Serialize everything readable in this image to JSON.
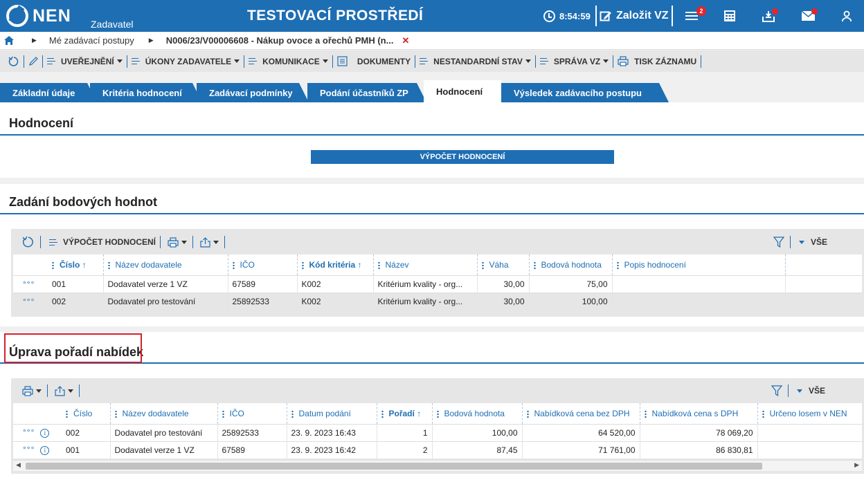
{
  "topbar": {
    "logo": "NEN",
    "logo_sub": "Zadavatel",
    "env_title": "TESTOVACÍ PROSTŘEDÍ",
    "time": "8:54:59",
    "create_label": "Založit VZ",
    "menu_badge": "2",
    "colors": {
      "primary": "#1e6eb3",
      "badge": "#e6252b"
    }
  },
  "breadcrumb": {
    "items": [
      "Mé zadávací postupy",
      "N006/23/V00006608 - Nákup ovoce a ořechů PMH (n..."
    ],
    "close_glyph": "✕"
  },
  "toolbar": {
    "items": [
      "UVEŘEJNĚNÍ",
      "ÚKONY ZADAVATELE",
      "KOMUNIKACE",
      "DOKUMENTY",
      "NESTANDARDNÍ STAV",
      "SPRÁVA VZ",
      "TISK ZÁZNAMU"
    ]
  },
  "tabs": [
    "Základní údaje",
    "Kritéria hodnocení",
    "Zadávací podmínky",
    "Podání účastníků ZP",
    "Hodnocení",
    "Výsledek zadávacího postupu"
  ],
  "section1": {
    "title": "Hodnocení",
    "button": "VÝPOČET HODNOCENÍ"
  },
  "section2": {
    "title": "Zadání bodových hodnot",
    "toolbar_button": "VÝPOČET HODNOCENÍ",
    "filter_label": "VŠE",
    "columns": [
      "Číslo",
      "Název dodavatele",
      "IČO",
      "Kód kritéria",
      "Název",
      "Váha",
      "Bodová hodnota",
      "Popis hodnocení"
    ],
    "rows": [
      {
        "cislo": "001",
        "nazev_dodavatele": "Dodavatel verze 1 VZ",
        "ico": "67589",
        "kod": "K002",
        "nazev": "Kritérium kvality - org...",
        "vaha": "30,00",
        "bodova": "75,00",
        "popis": ""
      },
      {
        "cislo": "002",
        "nazev_dodavatele": "Dodavatel pro testování",
        "ico": "25892533",
        "kod": "K002",
        "nazev": "Kritérium kvality - org...",
        "vaha": "30,00",
        "bodova": "100,00",
        "popis": ""
      }
    ]
  },
  "section3": {
    "title": "Úprava pořadí nabídek",
    "filter_label": "VŠE",
    "columns": [
      "Číslo",
      "Název dodavatele",
      "IČO",
      "Datum podání",
      "Pořadí",
      "Bodová hodnota",
      "Nabídková cena bez DPH",
      "Nabídková cena s DPH",
      "Určeno losem v NEN"
    ],
    "rows": [
      {
        "cislo": "002",
        "nazev_dodavatele": "Dodavatel pro testování",
        "ico": "25892533",
        "datum": "23. 9. 2023 16:43",
        "poradi": "1",
        "bodova": "100,00",
        "cena_bez": "64 520,00",
        "cena_s": "78 069,20",
        "los": ""
      },
      {
        "cislo": "001",
        "nazev_dodavatele": "Dodavatel verze 1 VZ",
        "ico": "67589",
        "datum": "23. 9. 2023 16:42",
        "poradi": "2",
        "bodova": "87,45",
        "cena_bez": "71 761,00",
        "cena_s": "86 830,81",
        "los": ""
      }
    ]
  }
}
